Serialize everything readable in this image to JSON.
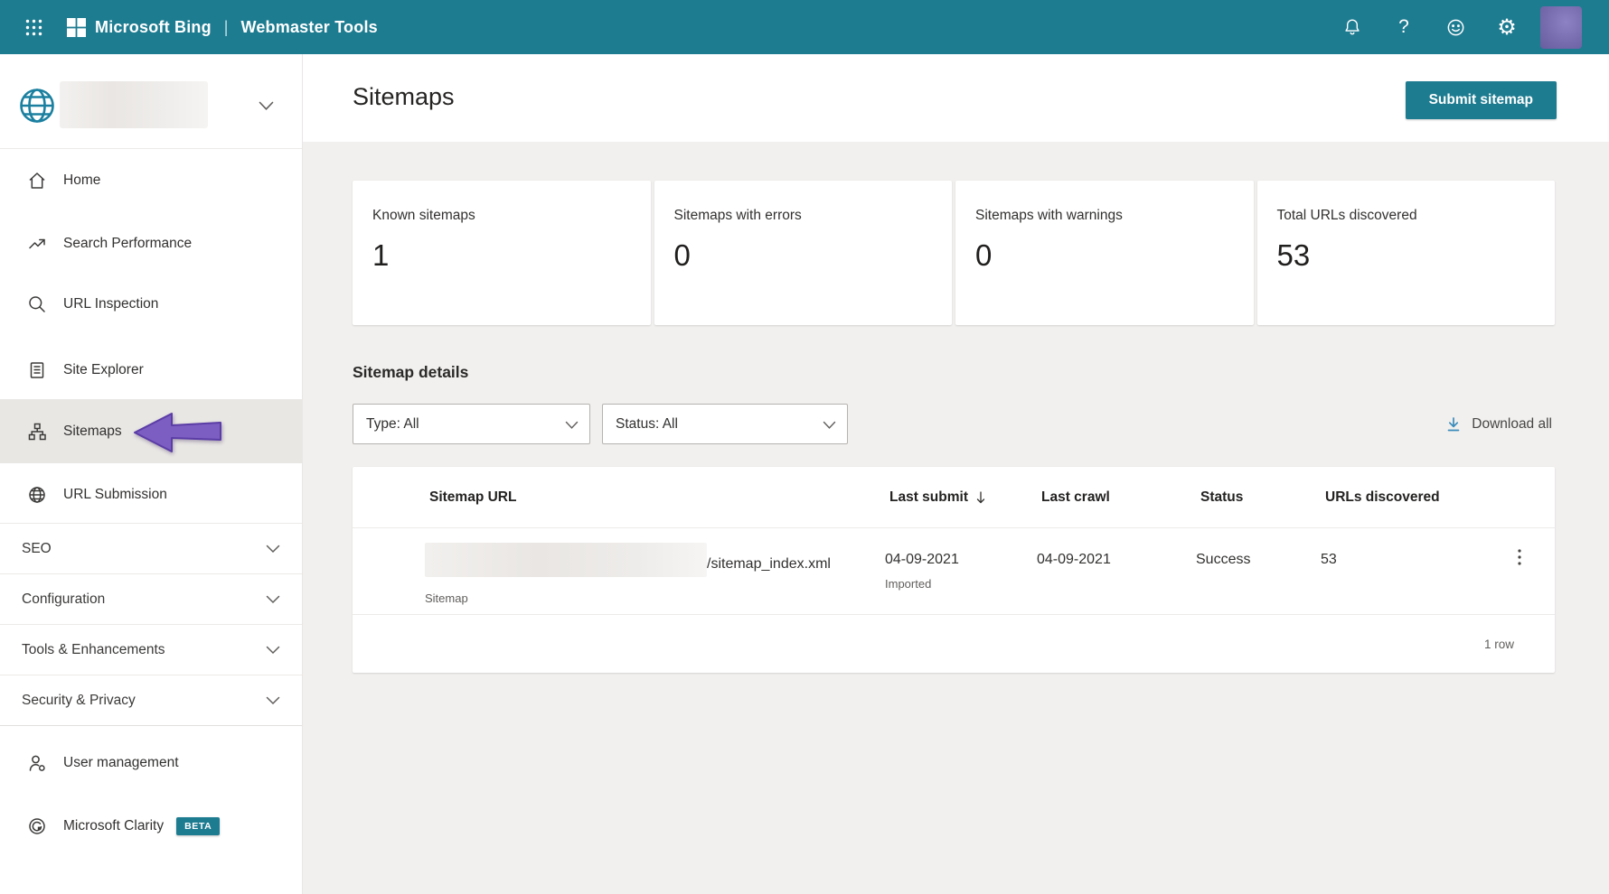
{
  "colors": {
    "accent_teal": "#1e7c91",
    "annotation_arrow_purple": "#7c5dc1",
    "download_icon_blue": "#3a8bbb",
    "active_item_bg": "#e9e7e4",
    "main_bg": "#f1f0ee"
  },
  "header": {
    "brand": "Microsoft Bing",
    "separator": "|",
    "product": "Webmaster Tools",
    "help_glyph": "?",
    "settings_glyph": "⚙",
    "icons": {
      "left": [
        "waffle-icon",
        "microsoft-logo"
      ],
      "right": [
        "bell-icon",
        "question-icon",
        "smiley-icon",
        "gear-icon",
        "avatar"
      ]
    }
  },
  "sidebar": {
    "site_selector": {
      "icon": "globe-icon",
      "name_blurred": "",
      "chevron": "chevron-down-icon"
    },
    "items": [
      {
        "label": "Home",
        "icon": "home-icon"
      },
      {
        "label": "Search Performance",
        "icon": "trend-up-icon"
      },
      {
        "label": "URL Inspection",
        "icon": "magnifier-icon"
      },
      {
        "label": "Site Explorer",
        "icon": "document-icon"
      },
      {
        "label": "Sitemaps",
        "icon": "sitemap-icon",
        "active": true
      },
      {
        "label": "URL Submission",
        "icon": "globe-icon"
      }
    ],
    "sections": [
      {
        "label": "SEO"
      },
      {
        "label": "Configuration"
      },
      {
        "label": "Tools & Enhancements"
      },
      {
        "label": "Security & Privacy"
      }
    ],
    "footer_items": [
      {
        "label": "User management",
        "icon": "person-icon"
      },
      {
        "label": "Microsoft Clarity",
        "icon": "clarity-icon",
        "badge": "BETA"
      }
    ]
  },
  "page": {
    "title": "Sitemaps",
    "submit_button": "Submit sitemap"
  },
  "stats": [
    {
      "label": "Known sitemaps",
      "value": "1"
    },
    {
      "label": "Sitemaps with errors",
      "value": "0"
    },
    {
      "label": "Sitemaps with warnings",
      "value": "0"
    },
    {
      "label": "Total URLs discovered",
      "value": "53"
    }
  ],
  "details": {
    "heading": "Sitemap details",
    "type_filter": "Type: All",
    "status_filter": "Status: All",
    "download_all": "Download all"
  },
  "table": {
    "headers": {
      "url": "Sitemap URL",
      "last_submit": "Last submit",
      "last_crawl": "Last crawl",
      "status": "Status",
      "urls_discovered": "URLs discovered"
    },
    "row": {
      "url_prefix_blurred": "",
      "url_suffix": "/sitemap_index.xml",
      "type": "Sitemap",
      "last_submit": "04-09-2021",
      "submit_note": "Imported",
      "last_crawl": "04-09-2021",
      "status": "Success",
      "urls_discovered": "53"
    },
    "footer": "1 row"
  }
}
